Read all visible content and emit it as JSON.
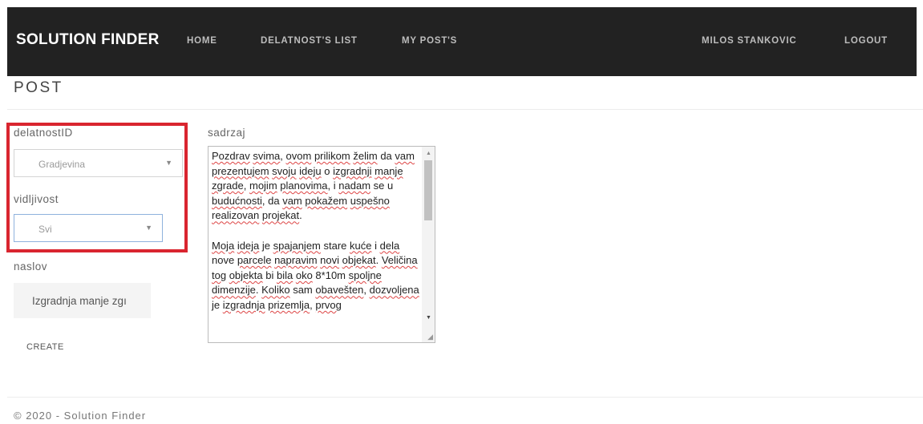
{
  "navbar": {
    "brand": "SOLUTION FINDER",
    "links": [
      "HOME",
      "DELATNOST'S LIST",
      "MY POST'S"
    ],
    "user": "MILOS STANKOVIC",
    "logout": "LOGOUT"
  },
  "page": {
    "title": "POST"
  },
  "form": {
    "delatnost_label": "delatnostID",
    "delatnost_value": "Gradjevina",
    "vidljivost_label": "vidljivost",
    "vidljivost_value": "Svi",
    "naslov_label": "naslov",
    "naslov_value": "Izgradnja manje zgı",
    "create_label": "CREATE",
    "sadrzaj_label": "sadrzaj"
  },
  "sadrzaj_value": "Pozdrav svima, ovom prilikom želim da vam prezentujem svoju ideju o izgradnji manje zgrade, mojim planovima, i nadam se u budućnosti, da vam pokažem uspešno realizovan projekat.\n\nMoja ideja je spajanjem stare kuće i dela nove parcele napravim novi objekat. Veličina tog objekta bi bila oko 8*10m spoljne dimenzije. Koliko sam obavešten, dozvoljena je izgradnja prizemlja, prvog",
  "footer": {
    "text": "© 2020 - Solution Finder"
  },
  "colors": {
    "navbar_bg": "#222222",
    "highlight_border": "#d9252f"
  }
}
